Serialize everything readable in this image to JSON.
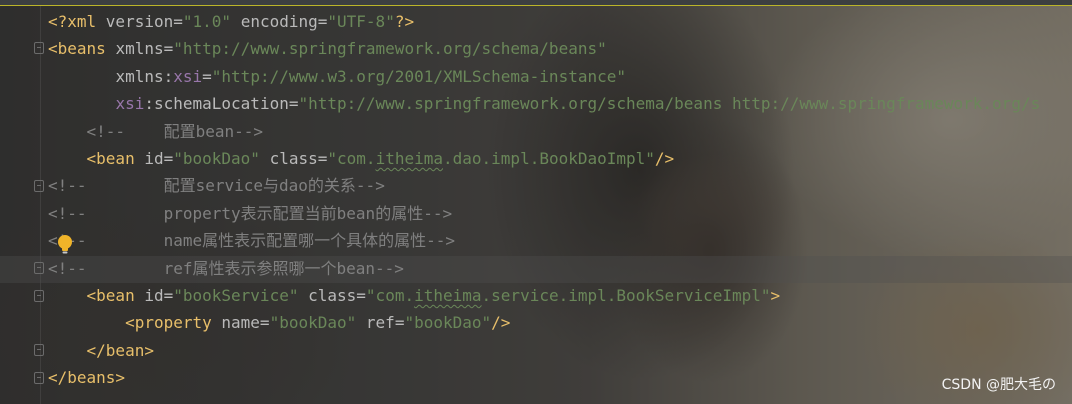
{
  "colors": {
    "tag": "#e8bf6a",
    "attribute": "#bababa",
    "namespace": "#9876aa",
    "string": "#6a8759",
    "comment": "#808080"
  },
  "code": {
    "l1": {
      "open": "<?xml ",
      "a1": "version",
      "eq1": "=",
      "v1": "\"1.0\"",
      "sp1": " ",
      "a2": "encoding",
      "eq2": "=",
      "v2": "\"UTF-8\"",
      "close": "?>"
    },
    "l2": {
      "open": "<beans ",
      "a1": "xmlns",
      "eq1": "=",
      "v1": "\"http://www.springframework.org/schema/beans\""
    },
    "l3": {
      "indent": "       ",
      "a1": "xmlns:",
      "ns": "xsi",
      "eq1": "=",
      "v1": "\"http://www.w3.org/2001/XMLSchema-instance\""
    },
    "l4": {
      "indent": "       ",
      "ns": "xsi",
      "a1": ":schemaLocation",
      "eq1": "=",
      "v1": "\"http://www.springframework.org/schema/beans http://www.springframework.org/s"
    },
    "l5": {
      "text": "    <!--    配置bean-->"
    },
    "l6": {
      "indent": "    ",
      "open": "<bean ",
      "a1": "id",
      "eq1": "=",
      "v1": "\"bookDao\"",
      "sp1": " ",
      "a2": "class",
      "eq2": "=",
      "v2a": "\"com.",
      "v2u": "itheima",
      "v2b": ".dao.impl.BookDaoImpl\"",
      "close": "/>"
    },
    "l7": {
      "text": "<!--        配置service与dao的关系-->"
    },
    "l8": {
      "text": "<!--        property表示配置当前bean的属性-->"
    },
    "l9": {
      "text": "<!--        name属性表示配置哪一个具体的属性-->"
    },
    "l10": {
      "text": "<!--        ref属性表示参照哪一个bean-->"
    },
    "l11": {
      "indent": "    ",
      "open": "<bean ",
      "a1": "id",
      "eq1": "=",
      "v1": "\"bookService\"",
      "sp1": " ",
      "a2": "class",
      "eq2": "=",
      "v2a": "\"com.",
      "v2u": "itheima",
      "v2b": ".service.impl.BookServiceImpl\"",
      "close": ">"
    },
    "l12": {
      "indent": "        ",
      "open": "<property ",
      "a1": "name",
      "eq1": "=",
      "v1": "\"bookDao\"",
      "sp1": " ",
      "a2": "ref",
      "eq2": "=",
      "v2": "\"bookDao\"",
      "close": "/>"
    },
    "l13": {
      "indent": "    ",
      "tag": "</bean>"
    },
    "l14": {
      "tag": "</beans>"
    }
  },
  "watermark": "CSDN @肥大毛の",
  "icons": {
    "intention": "lightbulb-icon",
    "fold": "fold-marker-icon"
  }
}
